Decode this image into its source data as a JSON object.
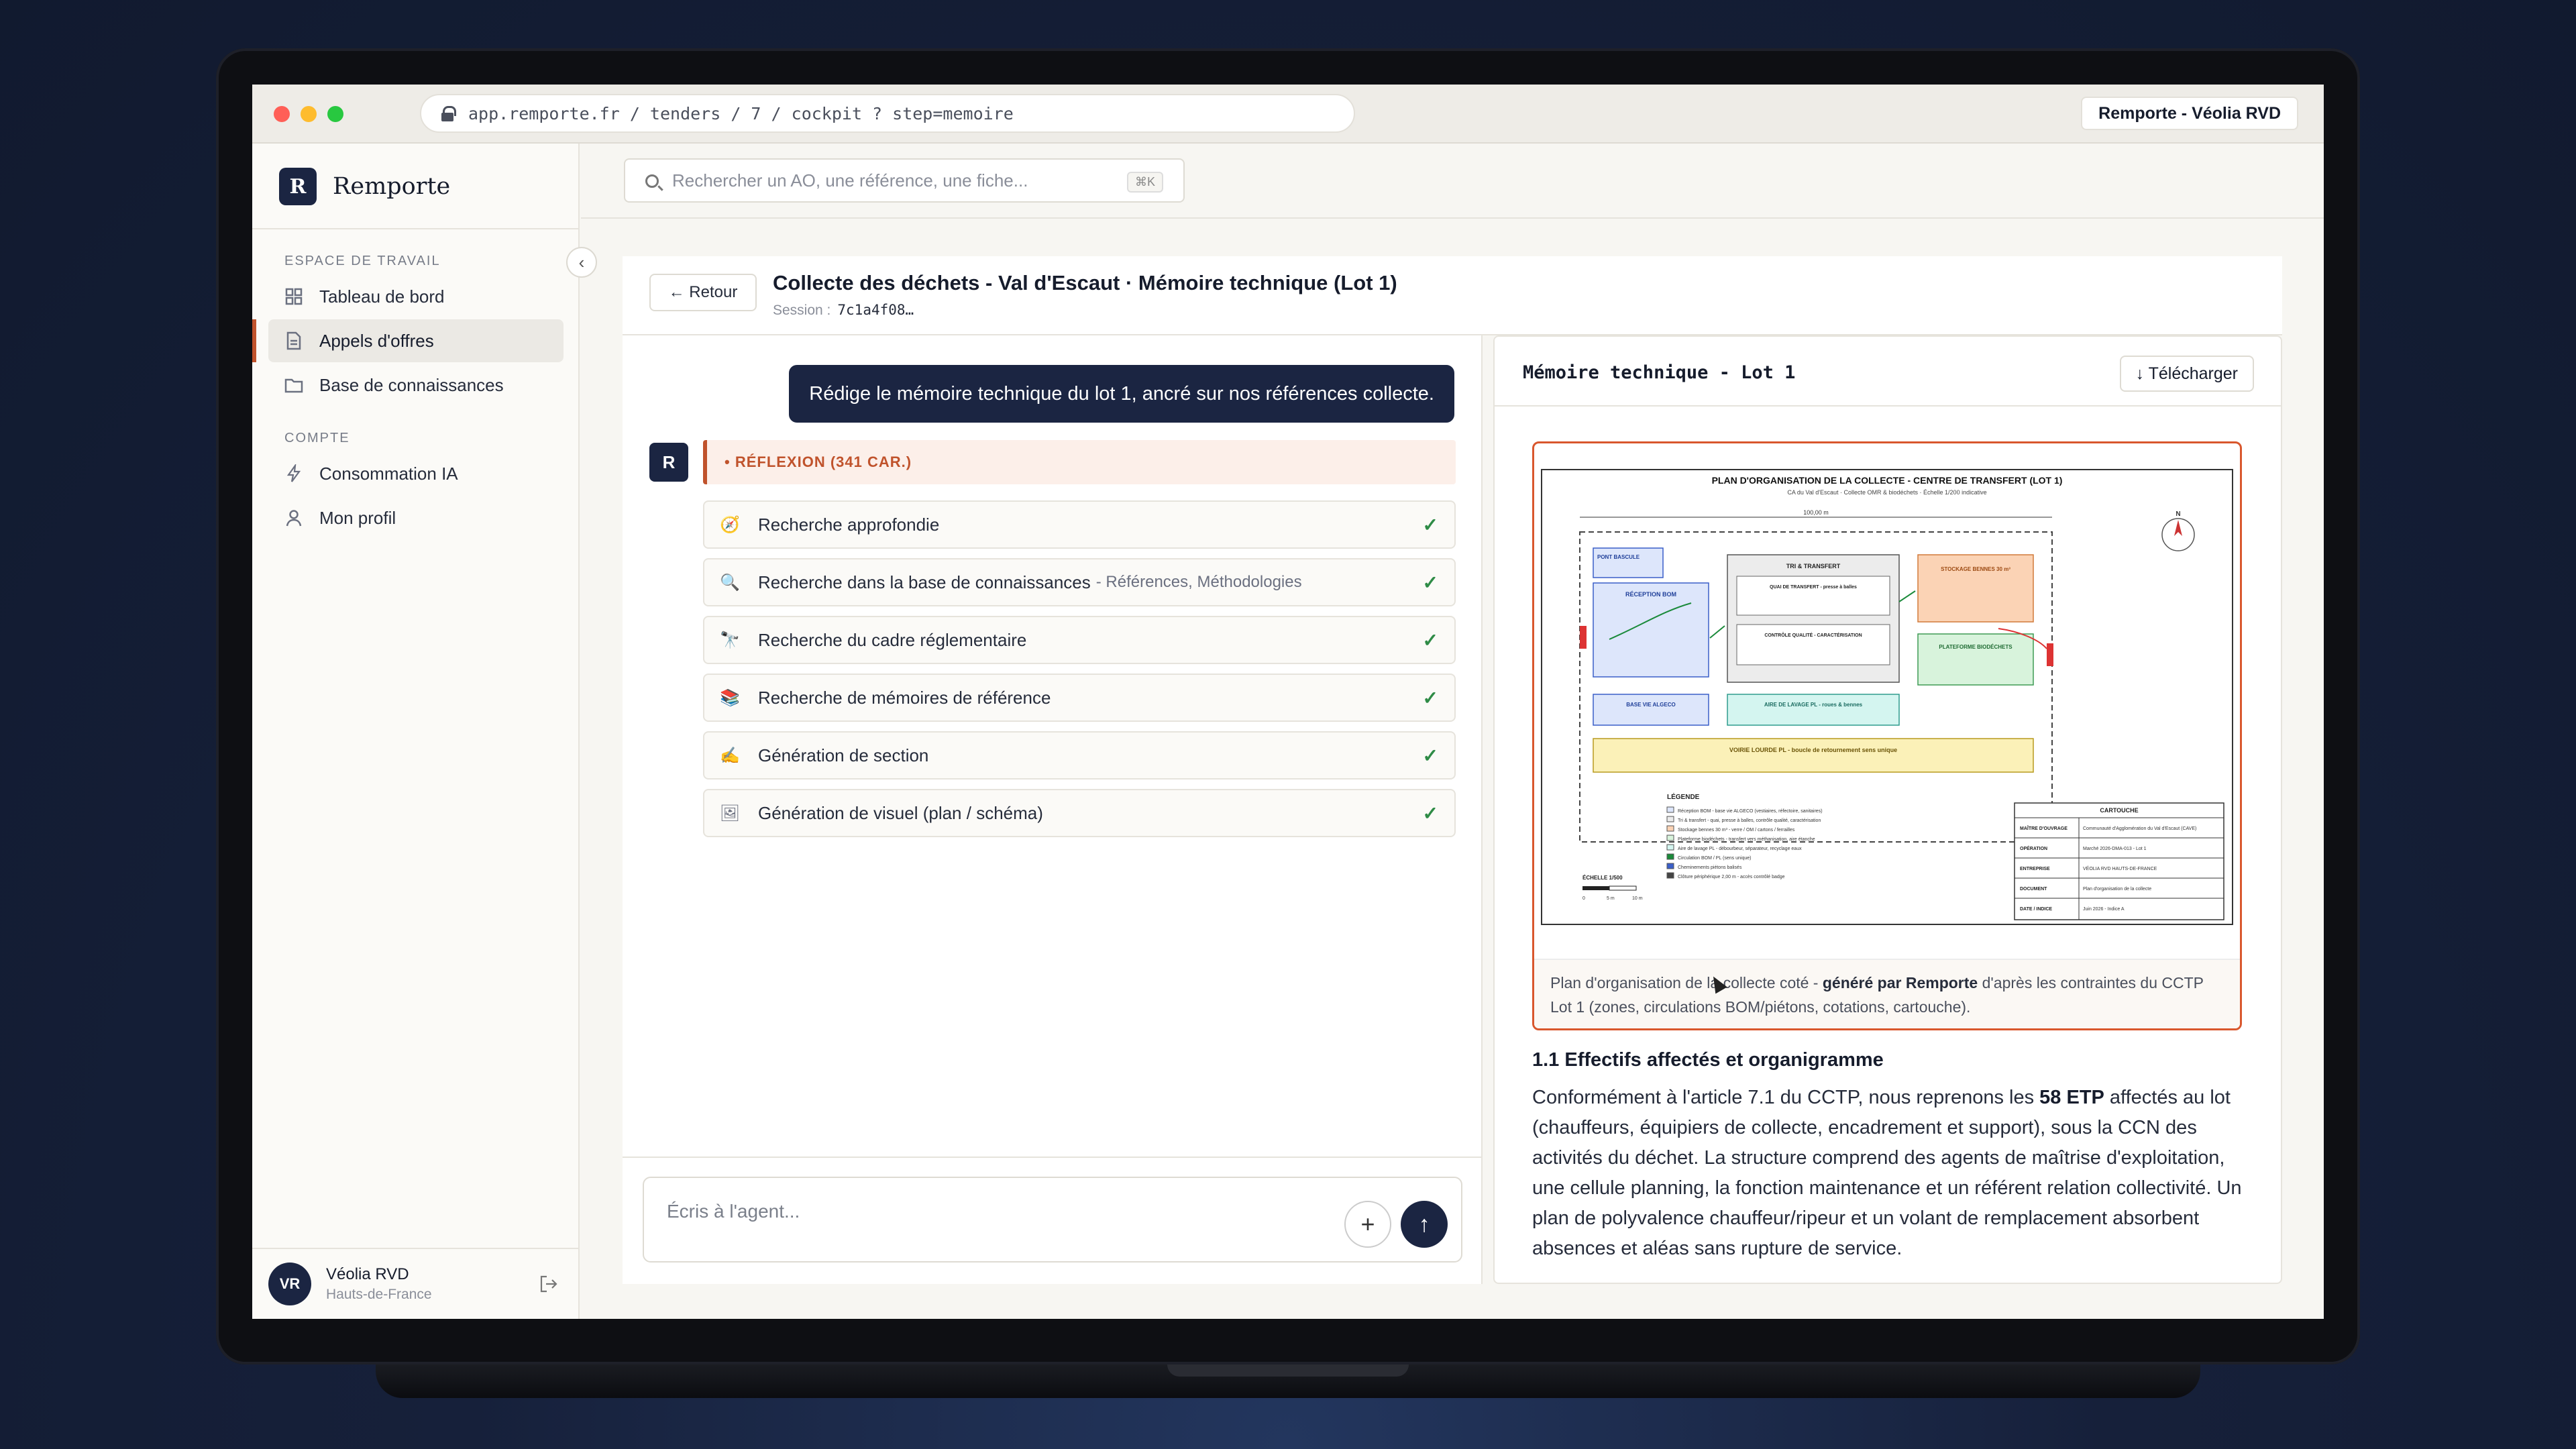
{
  "browser": {
    "url": "app.remporte.fr / tenders / 7 / cockpit ? step=memoire",
    "tenant_label": "Remporte - Véolia RVD"
  },
  "sidebar": {
    "brand_letter": "R",
    "brand_name": "Remporte",
    "workspace_label": "ESPACE DE TRAVAIL",
    "workspace_items": [
      {
        "label": "Tableau de bord",
        "icon": "dashboard-icon"
      },
      {
        "label": "Appels d'offres",
        "icon": "document-icon",
        "active": true
      },
      {
        "label": "Base de connaissances",
        "icon": "folder-icon"
      }
    ],
    "account_label": "COMPTE",
    "account_items": [
      {
        "label": "Consommation IA",
        "icon": "lightning-icon"
      },
      {
        "label": "Mon profil",
        "icon": "user-icon"
      }
    ],
    "user": {
      "initials": "VR",
      "name": "Véolia RVD",
      "region": "Hauts-de-France"
    }
  },
  "search": {
    "placeholder": "Rechercher un AO, une référence, une fiche...",
    "shortcut": "⌘K"
  },
  "header": {
    "back_label": "← Retour",
    "title": "Collecte des déchets - Val d'Escaut · Mémoire technique (Lot 1)",
    "session_label": "Session :",
    "session_code": "7c1a4f08…"
  },
  "chat": {
    "user_message": "Rédige le mémoire technique du lot 1, ancré sur nos références collecte.",
    "agent_initial": "R",
    "reflection_label": "• RÉFLEXION (341 CAR.)",
    "steps": [
      {
        "label": "Recherche approfondie",
        "sub": "",
        "icon": "compass-icon"
      },
      {
        "label": "Recherche dans la base de connaissances",
        "sub": "- Références, Méthodologies",
        "icon": "search-icon"
      },
      {
        "label": "Recherche du cadre réglementaire",
        "sub": "",
        "icon": "telescope-icon"
      },
      {
        "label": "Recherche de mémoires de référence",
        "sub": "",
        "icon": "books-icon"
      },
      {
        "label": "Génération de section",
        "sub": "",
        "icon": "writing-hand-icon"
      },
      {
        "label": "Génération de visuel (plan / schéma)",
        "sub": "",
        "icon": "picture-icon"
      }
    ],
    "composer_placeholder": "Écris à l'agent..."
  },
  "document": {
    "title": "Mémoire technique - Lot 1",
    "download_label": "↓ Télécharger",
    "plan": {
      "title": "PLAN D'ORGANISATION DE LA COLLECTE - CENTRE DE TRANSFERT (LOT 1)",
      "subtitle": "CA du Val d'Escaut · Collecte OMR & biodéchets · Échelle 1/200 indicative",
      "dimension": "100,00 m",
      "zones": {
        "pont": "PONT BASCULE",
        "reception": "RÉCEPTION BOM",
        "tri": "TRI & TRANSFERT",
        "quai": "QUAI DE TRANSFERT - presse à balles",
        "controle": "CONTRÔLE QUALITÉ - CARACTÉRISATION",
        "stockage": "STOCKAGE BENNES 30 m³",
        "plateforme": "PLATEFORME BIODÉCHETS",
        "base_vie": "BASE VIE ALGECO",
        "lavage": "AIRE DE LAVAGE PL - roues & bennes",
        "voirie": "VOIRIE LOURDE PL - boucle de retournement sens unique"
      },
      "legend_title": "LÉGENDE",
      "legend_items": [
        "Réception BOM - base vie ALGECO (vestiaires, réfectoire, sanitaires)",
        "Tri & transfert - quai, presse à balles, contrôle qualité, caractérisation",
        "Stockage bennes 30 m³ - verre / OM / cartons / ferrailles",
        "Plateforme biodéchets - transfert vers méthanisation, aire étanche",
        "Aire de lavage PL - débourbeur, séparateur, recyclage eaux",
        "Circulation BOM / PL (sens unique)",
        "Cheminements piétons balisés",
        "Clôture périphérique 2,00 m - accès contrôlé badge"
      ],
      "cartouche_title": "CARTOUCHE",
      "cartouche_rows": [
        {
          "k": "MAÎTRE D'OUVRAGE",
          "v": "Communauté d'Agglomération du Val d'Escaut (CAVE)"
        },
        {
          "k": "OPÉRATION",
          "v": "Marché 2026-DMA-013 - Lot 1"
        },
        {
          "k": "ENTREPRISE",
          "v": "VÉOLIA RVD HAUTS-DE-FRANCE"
        },
        {
          "k": "DOCUMENT",
          "v": "Plan d'organisation de la collecte"
        },
        {
          "k": "DATE / INDICE",
          "v": "Juin 2026 - Indice A"
        }
      ],
      "scale_label": "ÉCHELLE 1/500",
      "scale_ticks": [
        "0",
        "5 m",
        "10 m"
      ],
      "north": "N"
    },
    "caption_pre": "Plan d'organisation de la collecte coté - ",
    "caption_bold": "généré par Remporte",
    "caption_post": " d'après les contraintes du CCTP Lot 1 (zones, circulations BOM/piétons, cotations, cartouche).",
    "section_title": "1.1 Effectifs affectés et organigramme",
    "para_1": "Conformément à l'article 7.1 du CCTP, nous reprenons les ",
    "para_bold": "58 ETP",
    "para_2": " affectés au lot (chauffeurs, équipiers de collecte, encadrement et support), sous la CCN des activités du déchet. La structure comprend des agents de maîtrise d'exploitation, une cellule planning, la fonction maintenance et un référent relation collectivité. Un plan de polyvalence chauffeur/ripeur et un volant de remplacement absorbent absences et aléas sans rupture de service."
  }
}
